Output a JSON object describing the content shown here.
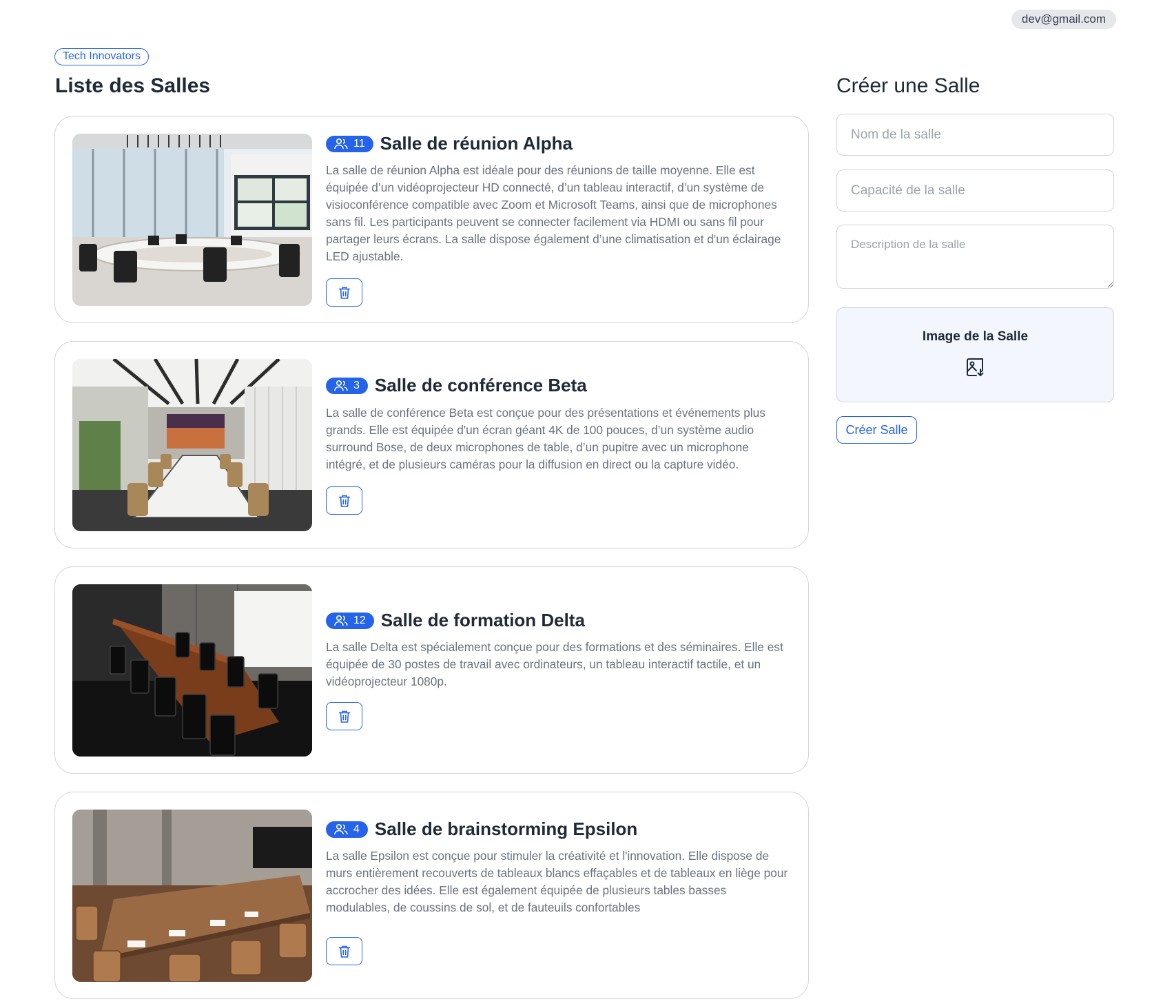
{
  "user": {
    "email": "dev@gmail.com"
  },
  "organization": {
    "name": "Tech Innovators"
  },
  "list": {
    "title": "Liste des Salles"
  },
  "rooms": [
    {
      "capacity": "11",
      "name": "Salle de réunion Alpha",
      "description": "La salle de réunion Alpha est idéale pour des réunions de taille moyenne. Elle est équipée d’un vidéoprojecteur HD connecté, d’un tableau interactif, d’un système de visioconférence compatible avec Zoom et Microsoft Teams, ainsi que de microphones sans fil. Les participants peuvent se connecter facilement via HDMI ou sans fil pour partager leurs écrans. La salle dispose également d’une climatisation et d'un éclairage LED ajustable."
    },
    {
      "capacity": "3",
      "name": "Salle de conférence Beta",
      "description": "La salle de conférence Beta est conçue pour des présentations et événements plus grands. Elle est équipée d'un écran géant 4K de 100 pouces, d’un système audio surround Bose, de deux microphones de table, d’un pupitre avec un microphone intégré, et de plusieurs caméras pour la diffusion en direct ou la capture vidéo."
    },
    {
      "capacity": "12",
      "name": "Salle de formation Delta",
      "description": "La salle Delta est spécialement conçue pour des formations et des séminaires. Elle est équipée de 30 postes de travail avec ordinateurs, un tableau interactif tactile, et un vidéoprojecteur 1080p."
    },
    {
      "capacity": "4",
      "name": "Salle de brainstorming Epsilon",
      "description": "La salle Epsilon est conçue pour stimuler la créativité et l'innovation. Elle dispose de murs entièrement recouverts de tableaux blancs effaçables et de tableaux en liège pour accrocher des idées. Elle est également équipée de plusieurs tables basses modulables, de coussins de sol, et de fauteuils confortables"
    }
  ],
  "form": {
    "title": "Créer une Salle",
    "name_placeholder": "Nom de la salle",
    "capacity_placeholder": "Capacité de la salle",
    "description_placeholder": "Description de la salle",
    "image_label": "Image de la Salle",
    "submit_label": "Créer Salle"
  },
  "icons": {
    "capacity": "users-icon",
    "delete": "trash-icon",
    "upload": "image-upload-icon"
  },
  "colors": {
    "accent": "#2563eb",
    "text": "#1f2937",
    "muted": "#6b7280",
    "border": "#d1d5db",
    "drop_bg": "#f3f6fc"
  }
}
